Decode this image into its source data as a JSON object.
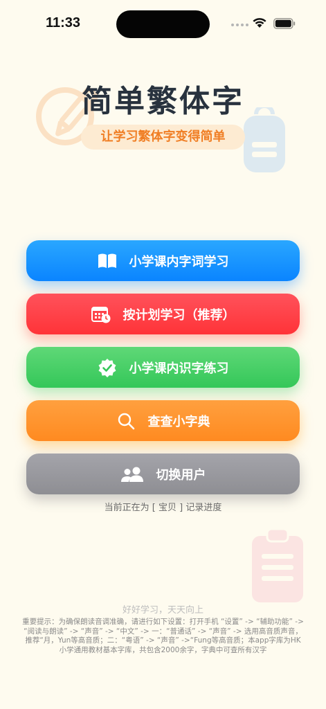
{
  "status_bar": {
    "time": "11:33"
  },
  "header": {
    "title": "简单繁体字",
    "subtitle": "让学习繁体字变得简单"
  },
  "menu": [
    {
      "label": "小学课内字词学习",
      "icon": "book-icon",
      "color": "#0a84ff"
    },
    {
      "label": "按计划学习（推荐）",
      "icon": "calendar-clock-icon",
      "color": "#ff3b30"
    },
    {
      "label": "小学课内识字练习",
      "icon": "checkmark-seal-icon",
      "color": "#34c759"
    },
    {
      "label": "查查小字典",
      "icon": "search-icon",
      "color": "#ff9500"
    },
    {
      "label": "切换用户",
      "icon": "users-icon",
      "color": "#8e8e93"
    }
  ],
  "current_user_text": "当前正在为 [ 宝贝 ] 记录进度",
  "motto": "好好学习，天天向上",
  "notice": "重要提示：为确保朗读音调准确，请进行如下设置：打开手机 “设置” -> “辅助功能” -> “阅读与朗读” -> “声音” -> “中文” -> 一：“普通话” -> “声音” -> 选用高音质声音，推荐“月，Yun等高音质；二：“粤语” -> “声音” ->“Fung等高音质；本app字库为HK小学通用教材基本字库，共包含2000余字，字典中可查所有汉字"
}
